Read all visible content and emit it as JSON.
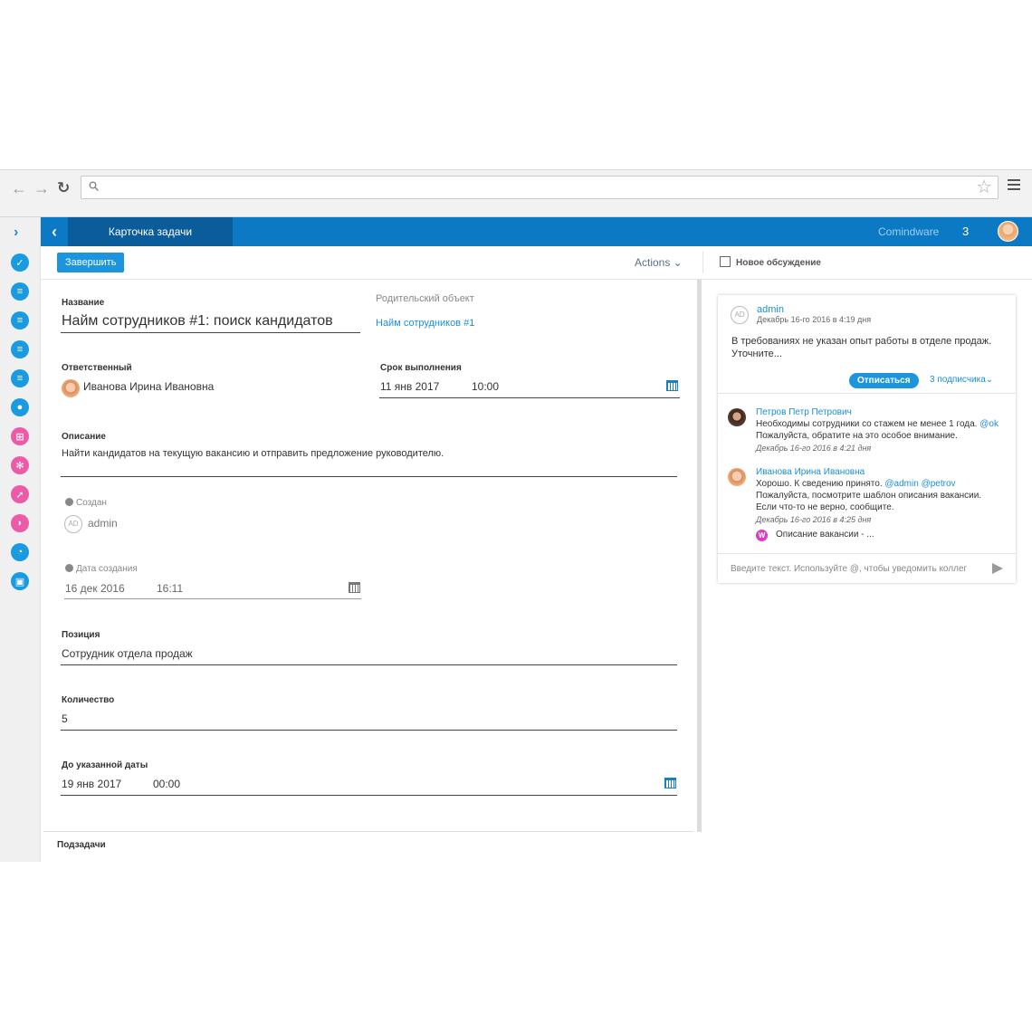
{
  "browser": {
    "back_icon": "back-arrow-icon",
    "forward_icon": "forward-arrow-icon",
    "reload_icon": "reload-icon",
    "address_value": "",
    "bookmark_icon": "star-icon",
    "menu_icon": "hamburger-icon"
  },
  "rail": {
    "expand_icon": "chevron-right-icon",
    "items": [
      {
        "icon": "check-circle-icon",
        "color": "#1a9be0"
      },
      {
        "icon": "document-icon",
        "color": "#1a9be0"
      },
      {
        "icon": "document-icon",
        "color": "#1a9be0"
      },
      {
        "icon": "document-icon",
        "color": "#1a9be0"
      },
      {
        "icon": "document-icon",
        "color": "#1a9be0"
      },
      {
        "icon": "user-icon",
        "color": "#1a9be0"
      },
      {
        "icon": "org-chart-icon",
        "color": "#ec5aa8"
      },
      {
        "icon": "gear-icon",
        "color": "#ec5aa8"
      },
      {
        "icon": "rocket-icon",
        "color": "#ec5aa8"
      },
      {
        "icon": "tag-icon",
        "color": "#ec5aa8"
      },
      {
        "icon": "pie-chart-icon",
        "color": "#1a9be0"
      },
      {
        "icon": "briefcase-icon",
        "color": "#1a9be0"
      }
    ]
  },
  "header": {
    "tab_title": "Карточка задачи",
    "company": "Comindware",
    "notification_count": "3",
    "accent_color": "#0c79c4"
  },
  "toolbar": {
    "complete_label": "Завершить",
    "actions_label": "Actions ⌄",
    "new_discussion_label": "Новое обсуждение"
  },
  "form": {
    "name_label": "Название",
    "name_value": "Найм сотрудников #1: поиск кандидатов",
    "parent_label": "Родительский объект",
    "parent_value": "Найм сотрудников #1",
    "assignee_label": "Ответственный",
    "assignee_value": "Иванова Ирина Ивановна",
    "due_label": "Срок выполнения",
    "due_date": "11 янв 2017",
    "due_time": "10:00",
    "description_label": "Описание",
    "description_value": "Найти кандидатов на текущую вакансию и отправить предложение руководителю.",
    "created_by_label": "Создан",
    "created_by_initials": "AD",
    "created_by_value": "admin",
    "created_date_label": "Дата создания",
    "created_date": "16 дек 2016",
    "created_time": "16:11",
    "position_label": "Позиция",
    "position_value": "Сотрудник отдела продаж",
    "quantity_label": "Количество",
    "quantity_value": "5",
    "until_label": "До указанной даты",
    "until_date": "19 янв 2017",
    "until_time": "00:00",
    "subtasks_label": "Подзадачи"
  },
  "discussion": {
    "author_initials": "AD",
    "author": "admin",
    "date": "Декабрь 16-го 2016 в 4:19 дня",
    "text": "В требованиях не указан опыт работы в отделе продаж. Уточните...",
    "unsubscribe_label": "Отписаться",
    "subscribers_label": "3 подписчика⌄",
    "comments": [
      {
        "author": "Петров Петр Петрович",
        "line1": "Необходимы сотрудники со стажем не менее 1 года.",
        "line1_mention": "@ok",
        "line2": "Пожалуйста, обратите на это особое внимание.",
        "date": "Декабрь 16-го 2016 в 4:21 дня"
      },
      {
        "author": "Иванова Ирина Ивановна",
        "line1": "Хорошо. К сведению принято.",
        "line1_mention": "@admin @petrov",
        "line2": "Пожалуйста, посмотрите шаблон описания вакансии.",
        "line3": "Если что-то не верно, сообщите.",
        "date": "Декабрь 16-го 2016 в 4:25 дня",
        "attachment_badge": "W",
        "attachment": "Описание вакансии - ..."
      }
    ],
    "input_placeholder": "Введите текст. Используйте @, чтобы уведомить коллег"
  }
}
